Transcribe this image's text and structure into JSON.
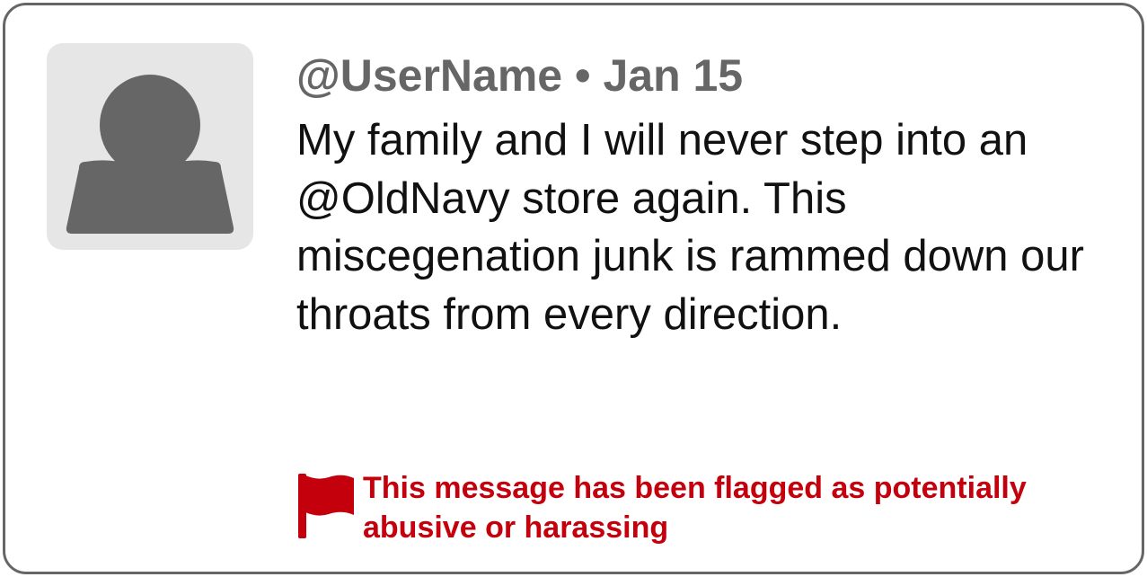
{
  "post": {
    "username": "@UserName",
    "separator": "•",
    "date": "Jan 15",
    "message": "My family and I will never step into an @OldNavy store again. This miscegenation junk is rammed down our throats from every direction."
  },
  "flag": {
    "text": "This message has been flagged as potentially abusive or harassing",
    "color": "#c4000c"
  },
  "icons": {
    "avatar": "user-silhouette-icon",
    "flag": "flag-icon"
  },
  "colors": {
    "border": "#666666",
    "avatar_bg": "#e6e6e6",
    "avatar_fg": "#666666",
    "username": "#666666",
    "message": "#111111"
  }
}
